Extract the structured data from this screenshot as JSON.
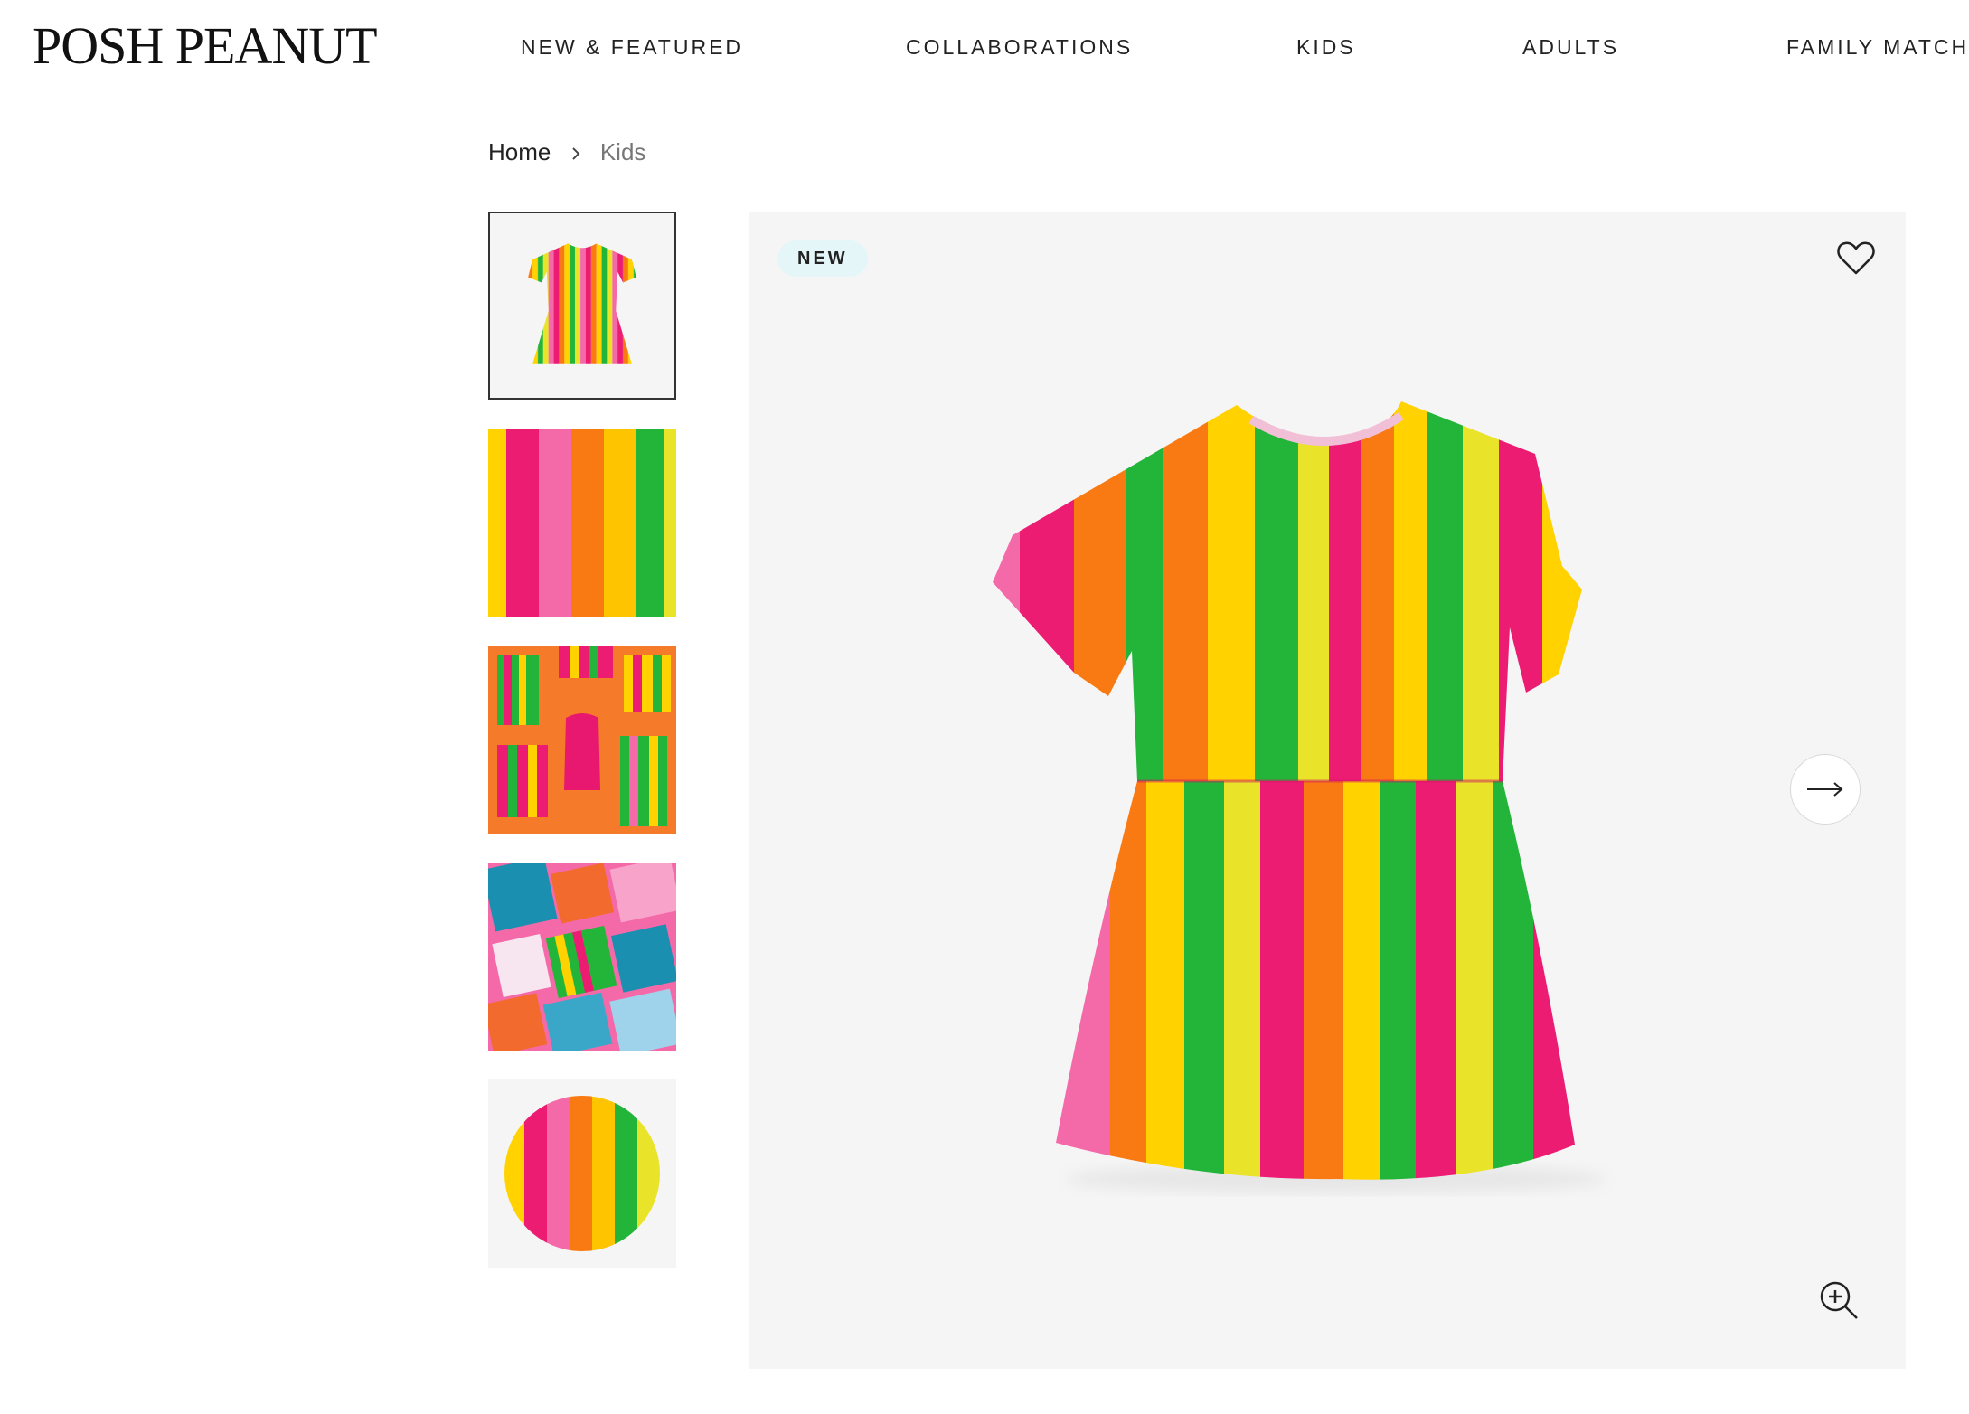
{
  "brand": {
    "logo_text": "POSH PEANUT"
  },
  "nav": {
    "items": [
      {
        "label": "NEW & FEATURED"
      },
      {
        "label": "COLLABORATIONS"
      },
      {
        "label": "KIDS"
      },
      {
        "label": "ADULTS"
      },
      {
        "label": "FAMILY MATCHI"
      }
    ]
  },
  "breadcrumb": {
    "home": "Home",
    "current": "Kids"
  },
  "gallery": {
    "thumbnails": [
      {
        "name": "striped-dress-front",
        "selected": true
      },
      {
        "name": "stripe-fabric-closeup",
        "selected": false
      },
      {
        "name": "swimwear-flatlay",
        "selected": false
      },
      {
        "name": "prints-collage",
        "selected": false
      },
      {
        "name": "stripe-swatch-circle",
        "selected": false
      }
    ],
    "badge": "NEW",
    "icons": {
      "wishlist": "heart-icon",
      "next": "arrow-right-icon",
      "zoom": "zoom-in-icon"
    }
  },
  "colors": {
    "pink": "#ec1c73",
    "light_pink": "#f46aa8",
    "orange": "#f97a12",
    "yellow": "#ffd200",
    "lime_yellow": "#e9e32a",
    "green": "#23b53a",
    "badge_bg": "#e4f6f7",
    "image_bg": "#f5f5f5"
  }
}
